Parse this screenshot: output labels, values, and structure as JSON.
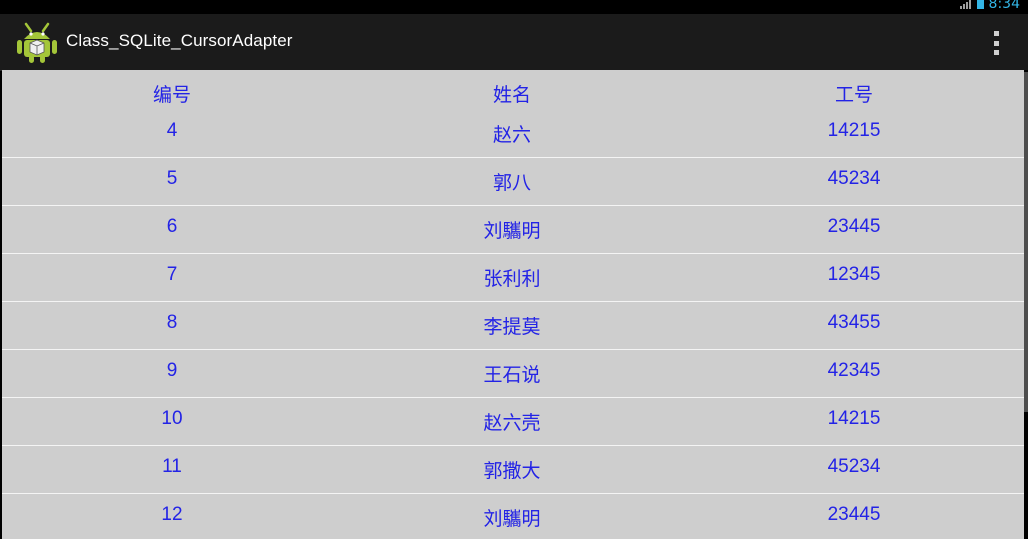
{
  "status_bar": {
    "time": "8:34"
  },
  "action_bar": {
    "title": "Class_SQLite_CursorAdapter",
    "overflow_menu_icon": "overflow-menu-icon",
    "app_icon": "android-icon"
  },
  "colors": {
    "text": "#2323e6",
    "list_background": "#cecece",
    "action_bar": "#1b1b1b"
  },
  "table": {
    "headers": [
      "编号",
      "姓名",
      "工号"
    ],
    "rows": [
      {
        "id": "4",
        "name": "赵六",
        "number": "14215"
      },
      {
        "id": "5",
        "name": "郭八",
        "number": "45234"
      },
      {
        "id": "6",
        "name": "刘驨明",
        "number": "23445"
      },
      {
        "id": "7",
        "name": "张利利",
        "number": "12345"
      },
      {
        "id": "8",
        "name": "李提莫",
        "number": "43455"
      },
      {
        "id": "9",
        "name": "王石说",
        "number": "42345"
      },
      {
        "id": "10",
        "name": "赵六壳",
        "number": "14215"
      },
      {
        "id": "11",
        "name": "郭撒大",
        "number": "45234"
      },
      {
        "id": "12",
        "name": "刘驨明",
        "number": "23445"
      }
    ]
  }
}
